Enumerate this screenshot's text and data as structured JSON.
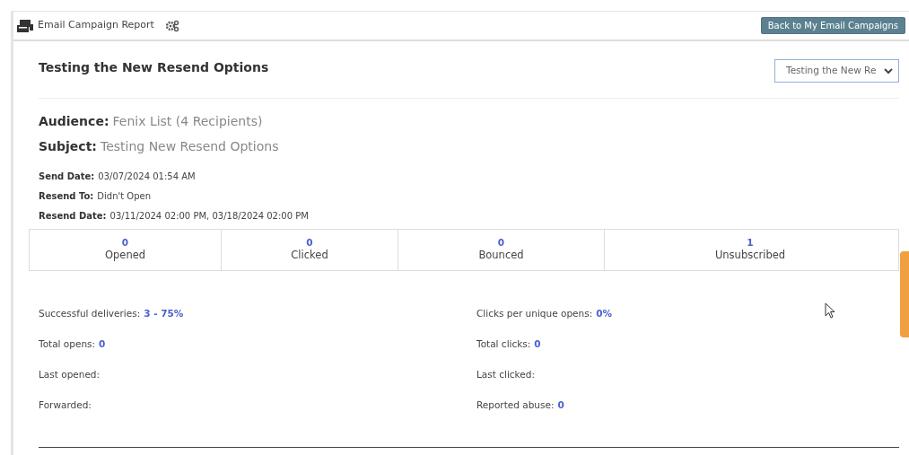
{
  "header": {
    "title": "Email Campaign Report",
    "back_button": "Back to My Email Campaigns"
  },
  "campaign": {
    "title": "Testing the New Resend Options",
    "selector_value": "Testing the New Re"
  },
  "main_details": [
    {
      "label": "Audience:",
      "value": "Fenix List (4 Recipients)"
    },
    {
      "label": "Subject:",
      "value": "Testing New Resend Options"
    }
  ],
  "dates": [
    {
      "label": "Send Date:",
      "value": "03/07/2024 01:54 AM"
    },
    {
      "label": "Resend To:",
      "value": "Didn't Open"
    },
    {
      "label": "Resend Date:",
      "value": "03/11/2024 02:00 PM, 03/18/2024 02:00 PM"
    }
  ],
  "summary": [
    {
      "count": "0",
      "label": "Opened"
    },
    {
      "count": "0",
      "label": "Clicked"
    },
    {
      "count": "0",
      "label": "Bounced"
    },
    {
      "count": "1",
      "label": "Unsubscribed"
    }
  ],
  "stats_left": [
    {
      "label": "Successful deliveries:",
      "value": "3 - 75%"
    },
    {
      "label": "Total opens:",
      "value": "0"
    },
    {
      "label": "Last opened:"
    },
    {
      "label": "Forwarded:"
    }
  ],
  "stats_right": [
    {
      "label": "Clicks per unique opens:",
      "value": "0%"
    },
    {
      "label": "Total clicks:",
      "value": "0"
    },
    {
      "label": "Last clicked:"
    },
    {
      "label": "Reported abuse:",
      "value": "0"
    }
  ]
}
